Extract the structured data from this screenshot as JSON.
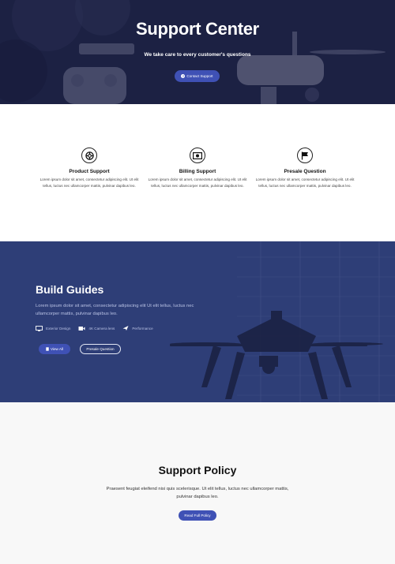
{
  "hero": {
    "title": "Support Center",
    "subtitle": "We take care to every customer's questions",
    "button_label": "Contact Support",
    "button_icon": "question-circle-icon"
  },
  "features": [
    {
      "icon": "lifebuoy-icon",
      "title": "Product Support",
      "text": "Lorem ipsum dolor sit amet, consectetur adipiscing elit. Ut elit tellus, luctus nec ullamcorper mattis, pulvinar dapibus leo."
    },
    {
      "icon": "money-icon",
      "title": "Billing Support",
      "text": "Lorem ipsum dolor sit amet, consectetur adipiscing elit. Ut elit tellus, luctus nec ullamcorper mattis, pulvinar dapibus leo."
    },
    {
      "icon": "flag-icon",
      "title": "Presale Question",
      "text": "Lorem ipsum dolor sit amet, consectetur adipiscing elit. Ut elit tellus, luctus nec ullamcorper mattis, pulvinar dapibus leo."
    }
  ],
  "guides": {
    "title": "Build Guides",
    "text": "Lorem ipsum dolor sit amet, consectetur adipiscing elit Ut elit tellus, luctus nec ullamcorper mattis, pulvinar dapibus leo.",
    "meta": [
      {
        "icon": "monitor-icon",
        "label": "Exterior Design"
      },
      {
        "icon": "video-camera-icon",
        "label": "4K Camera lens"
      },
      {
        "icon": "plane-icon",
        "label": "Performance"
      }
    ],
    "view_all_label": "View All",
    "presale_label": "Presale Question"
  },
  "policy": {
    "title": "Support Policy",
    "text": "Praesent feugiat eleifend nisi quis scelerisque. Ut elit tellus, luctus nec ullamcorper mattis, pulvinar dapibus leo.",
    "button_label": "Read Full Policy"
  },
  "colors": {
    "accent": "#3f51b5",
    "guides_bg": "#2f3f78",
    "hero_bg": "#1d2142"
  }
}
